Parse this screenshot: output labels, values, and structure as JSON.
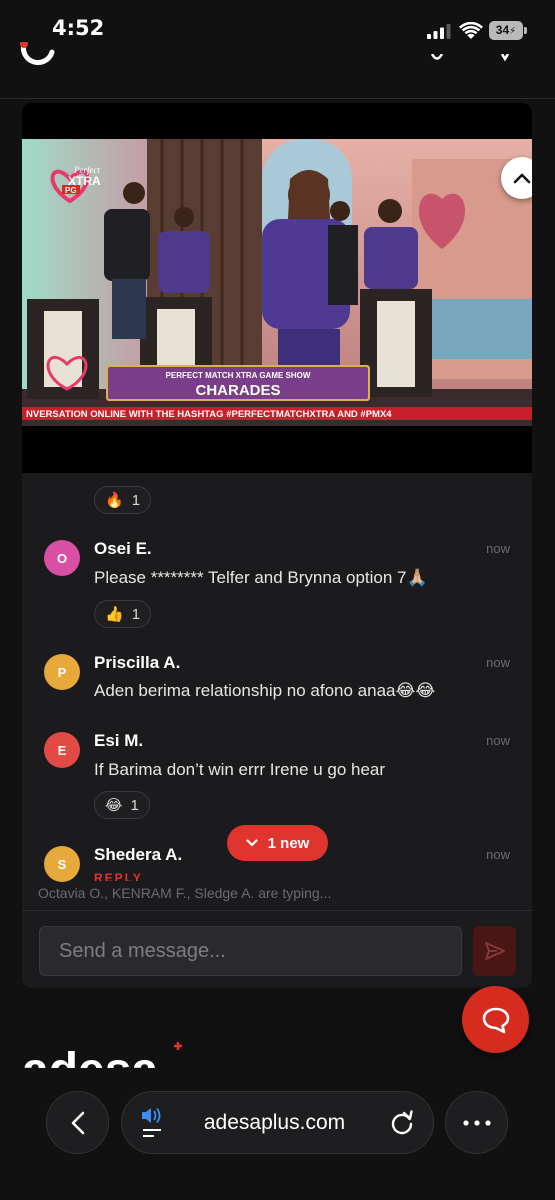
{
  "status_bar": {
    "time": "4:52",
    "battery": "34"
  },
  "video": {
    "lower_third_kicker": "PERFECT MATCH XTRA GAME SHOW",
    "lower_third_title": "CHARADES",
    "ticker": "NVERSATION ONLINE WITH THE HASHTAG #PERFECTMATCHXTRA AND #PMX4",
    "rating_badge": "PG",
    "logo_line1": "Perfect",
    "logo_line2": "XTRA"
  },
  "chat": {
    "top_reaction": {
      "emoji": "🔥",
      "count": "1"
    },
    "messages": [
      {
        "initial": "O",
        "name": "Osei E.",
        "time": "now",
        "text": "Please ******** Telfer and Brynna option 7🙏🏼",
        "color": "#d94fa3",
        "reaction": {
          "emoji": "👍",
          "count": "1"
        }
      },
      {
        "initial": "P",
        "name": "Priscilla A.",
        "time": "now",
        "text": "Aden berima relationship no afono anaa😂😂",
        "color": "#e7a93a"
      },
      {
        "initial": "E",
        "name": "Esi M.",
        "time": "now",
        "text": "If Barima don’t win errr Irene u go hear",
        "color": "#e24a45",
        "reaction": {
          "emoji": "😂",
          "count": "1"
        }
      },
      {
        "initial": "S",
        "name": "Shedera A.",
        "time": "now",
        "color": "#e7a93a"
      }
    ],
    "new_pill": "1 new",
    "reply_partial": "REPLY",
    "typing": "Octavia O., KENRAM F., Sledge A. are typing...",
    "input_placeholder": "Send a message..."
  },
  "browser": {
    "url": "adesaplus.com"
  },
  "colors": {
    "accent": "#e0352f",
    "background": "#111112",
    "card": "#1b1b1d"
  }
}
